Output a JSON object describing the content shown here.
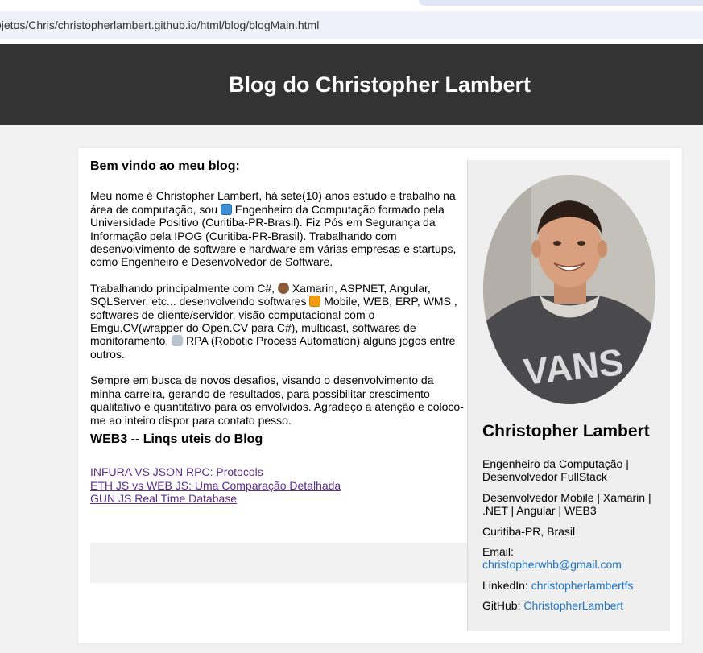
{
  "browser": {
    "url": "ojetos/Chris/christopherlambert.github.io/html/blog/blogMain.html"
  },
  "header": {
    "title": "Blog do Christopher Lambert"
  },
  "main": {
    "welcome": "Bem vindo ao meu blog:",
    "p1_a": "Meu nome é Christopher Lambert, há sete(10) anos estudo e trabalho na área de computação, sou",
    "p1_b": "Engenheiro da Computação formado pela Universidade Positivo (Curitiba-PR-Brasil). Fiz Pós em Segurança da Informação pela IPOG (Curitiba-PR-Brasil). Trabalhando com desenvolvimento de software e hardware em várias empresas e startups, como Engenheiro e Desenvolvedor de Software.",
    "p2_a": "Trabalhando principalmente com C#,",
    "p2_b": "Xamarin, ASPNET, Angular, SQLServer, etc... desenvolvendo softwares",
    "p2_c": "Mobile, WEB, ERP, WMS , softwares de cliente/servidor, visão computacional com o Emgu.CV(wrapper do Open.CV para C#), multicast, softwares de monitoramento,",
    "p2_d": "RPA (Robotic Process Automation) alguns jogos entre outros.",
    "p3": "Sempre em busca de novos desafios, visando o desenvolvimento da minha carreira, gerando de resultados, para possibilitar crescimento qualitativo e quantitativo para os envolvidos. Agradeço a atenção e coloco-me ao inteiro dispor para contato pesso.",
    "web3_title": "WEB3 -- Linqs uteis do Blog",
    "links": [
      "INFURA VS JSON RPC: Protocols",
      "ETH JS vs WEB JS: Uma Comparação Detalhada",
      "GUN JS Real Time Database"
    ]
  },
  "sidebar": {
    "name": "Christopher Lambert",
    "role": "Engenheiro da Computação | Desenvolvedor FullStack",
    "skills": "Desenvolvedor Mobile | Xamarin | .NET | Angular | WEB3",
    "location": "Curitiba-PR, Brasil",
    "email_label": "Email:",
    "email": "christopherwhb@gmail.com",
    "linkedin_label": "LinkedIn:",
    "linkedin": "christopherlambertfs",
    "github_label": "GitHub:",
    "github": "ChristopherLambert"
  },
  "icons": [
    "laptop-icon",
    "see-no-evil-monkey-icon",
    "mobile-phone-icon",
    "robot-icon"
  ],
  "colors": {
    "header_bg": "#333333",
    "link_visited": "#5b2d8c",
    "link": "#1a73c7",
    "sidebar_bg": "#efefef"
  }
}
